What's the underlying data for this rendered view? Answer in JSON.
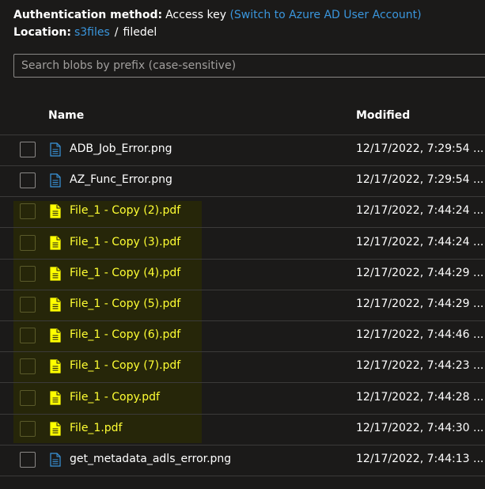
{
  "auth": {
    "label": "Authentication method:",
    "value": "Access key",
    "switch_link": "(Switch to Azure AD User Account)"
  },
  "location": {
    "label": "Location:",
    "container": "s3files",
    "separator": "/",
    "folder": "filedel"
  },
  "search": {
    "placeholder": "Search blobs by prefix (case-sensitive)",
    "value": ""
  },
  "table": {
    "headers": {
      "name": "Name",
      "modified": "Modified"
    },
    "rows": [
      {
        "name": "ADB_Job_Error.png",
        "modified": "12/17/2022, 7:29:54 ...",
        "type": "image",
        "highlighted": false
      },
      {
        "name": "AZ_Func_Error.png",
        "modified": "12/17/2022, 7:29:54 ...",
        "type": "image",
        "highlighted": false
      },
      {
        "name": "File_1 - Copy (2).pdf",
        "modified": "12/17/2022, 7:44:24 ...",
        "type": "pdf",
        "highlighted": true
      },
      {
        "name": "File_1 - Copy (3).pdf",
        "modified": "12/17/2022, 7:44:24 ...",
        "type": "pdf",
        "highlighted": true
      },
      {
        "name": "File_1 - Copy (4).pdf",
        "modified": "12/17/2022, 7:44:29 ...",
        "type": "pdf",
        "highlighted": true
      },
      {
        "name": "File_1 - Copy (5).pdf",
        "modified": "12/17/2022, 7:44:29 ...",
        "type": "pdf",
        "highlighted": true
      },
      {
        "name": "File_1 - Copy (6).pdf",
        "modified": "12/17/2022, 7:44:46 ...",
        "type": "pdf",
        "highlighted": true
      },
      {
        "name": "File_1 - Copy (7).pdf",
        "modified": "12/17/2022, 7:44:23 ...",
        "type": "pdf",
        "highlighted": true
      },
      {
        "name": "File_1 - Copy.pdf",
        "modified": "12/17/2022, 7:44:28 ...",
        "type": "pdf",
        "highlighted": true
      },
      {
        "name": "File_1.pdf",
        "modified": "12/17/2022, 7:44:30 ...",
        "type": "pdf",
        "highlighted": true
      },
      {
        "name": "get_metadata_adls_error.png",
        "modified": "12/17/2022, 7:44:13 ...",
        "type": "image",
        "highlighted": false
      }
    ]
  },
  "colors": {
    "background": "#1b1a19",
    "link": "#3a96dd",
    "highlight_text": "#ffff33",
    "highlight_bg": "#262609",
    "image_icon": "#3a96dd",
    "pdf_icon": "#ffff00"
  },
  "icons": {
    "image": "file-image-icon",
    "pdf": "file-pdf-icon"
  }
}
